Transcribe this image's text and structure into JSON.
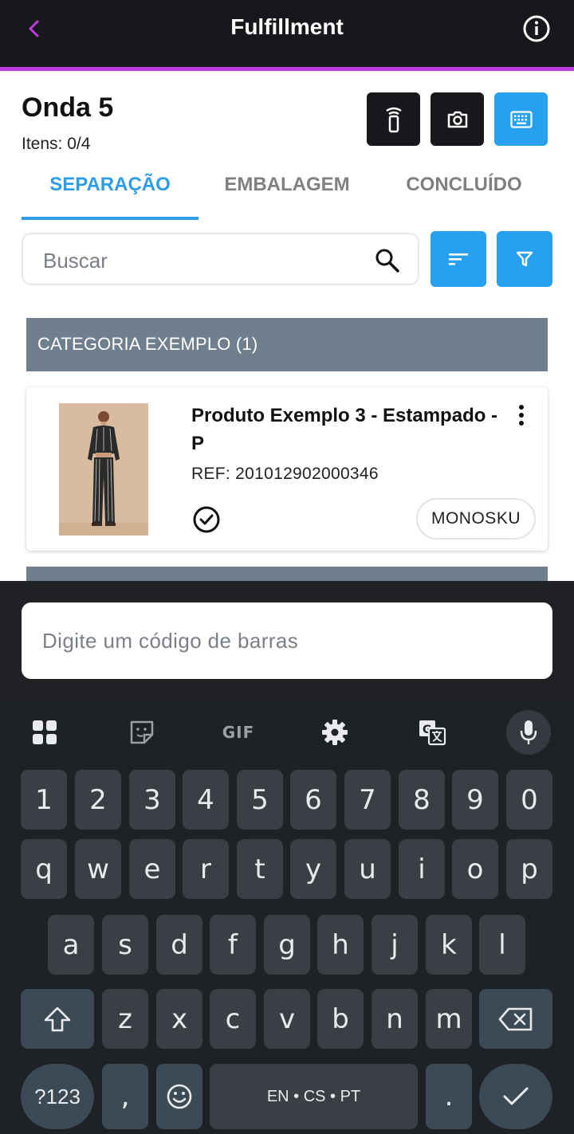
{
  "app_bar": {
    "title": "Fulfillment"
  },
  "header": {
    "title": "Onda 5",
    "items_label": "Itens: 0/4"
  },
  "tabs": [
    {
      "label": "SEPARAÇÃO",
      "active": true
    },
    {
      "label": "EMBALAGEM",
      "active": false
    },
    {
      "label": "CONCLUÍDO",
      "active": false
    }
  ],
  "search": {
    "placeholder": "Buscar"
  },
  "categories": [
    {
      "label": "CATEGORIA EXEMPLO (1)",
      "products": [
        {
          "name": "Produto Exemplo 3  - Estampado - P",
          "ref": "REF: 201012902000346",
          "tag": "MONOSKU"
        }
      ]
    }
  ],
  "barcode": {
    "placeholder": "Digite um código de barras"
  },
  "keyboard": {
    "row_numbers": [
      "1",
      "2",
      "3",
      "4",
      "5",
      "6",
      "7",
      "8",
      "9",
      "0"
    ],
    "row1": [
      "q",
      "w",
      "e",
      "r",
      "t",
      "y",
      "u",
      "i",
      "o",
      "p"
    ],
    "row2": [
      "a",
      "s",
      "d",
      "f",
      "g",
      "h",
      "j",
      "k",
      "l"
    ],
    "row3": [
      "z",
      "x",
      "c",
      "v",
      "b",
      "n",
      "m"
    ],
    "symbols_label": "?123",
    "comma": ",",
    "period": ".",
    "space_label": "EN • CS • PT",
    "gif_label": "GIF"
  },
  "colors": {
    "accent": "#27a0f0",
    "appbar": "#17181c",
    "appbar_line": "#c13ae0",
    "category": "#6f7f8d"
  }
}
